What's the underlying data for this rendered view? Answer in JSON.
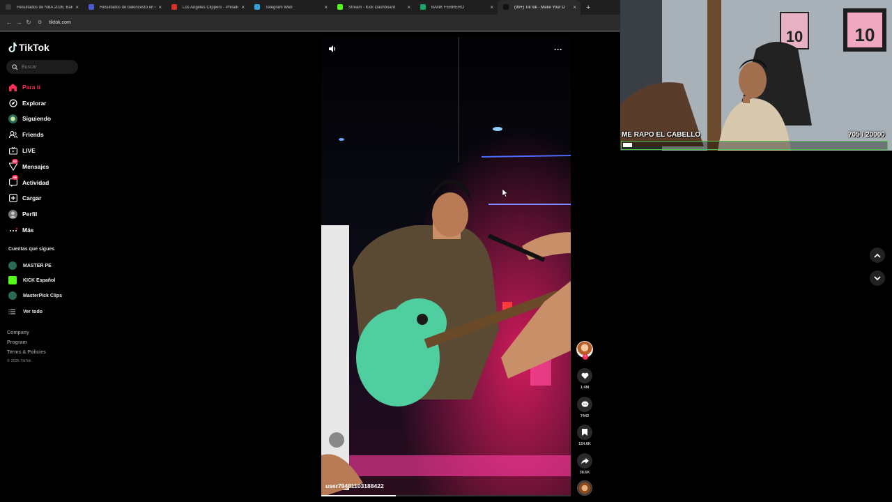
{
  "browser": {
    "tabs": [
      {
        "title": "Resultados de NBA 2026, Balon",
        "color": "#3c3c3c",
        "active": false
      },
      {
        "title": "Resultados de baloncesto en di",
        "color": "#4a5ad6",
        "active": false
      },
      {
        "title": "Los Angeles Clippers - Philadel",
        "color": "#d93025",
        "active": false
      },
      {
        "title": "Telegram Web",
        "color": "#2aa3de",
        "active": false
      },
      {
        "title": "Stream - Kick Dashboard",
        "color": "#53fc18",
        "active": false
      },
      {
        "title": "BANK FEBRERO",
        "color": "#16a765",
        "active": false
      },
      {
        "title": "(99+) TikTok - Make Your D",
        "color": "#111111",
        "active": true
      }
    ],
    "new_tab_label": "+",
    "url": "tiktok.com"
  },
  "sidebar": {
    "logo_text": "TikTok",
    "search_placeholder": "Buscar",
    "nav": [
      {
        "label": "Para ti",
        "icon": "home-icon",
        "active": true
      },
      {
        "label": "Explorar",
        "icon": "compass-icon",
        "active": false
      },
      {
        "label": "Siguiendo",
        "icon": "following-avatar-icon",
        "active": false
      },
      {
        "label": "Friends",
        "icon": "friends-icon",
        "active": false
      },
      {
        "label": "LIVE",
        "icon": "live-tv-icon",
        "active": false
      },
      {
        "label": "Mensajes",
        "icon": "send-icon",
        "active": false,
        "badge": "63"
      },
      {
        "label": "Actividad",
        "icon": "activity-icon",
        "active": false,
        "badge": "99"
      },
      {
        "label": "Cargar",
        "icon": "upload-icon",
        "active": false
      },
      {
        "label": "Perfil",
        "icon": "profile-avatar-icon",
        "active": false
      },
      {
        "label": "Más",
        "icon": "more-dots-icon",
        "active": false
      }
    ],
    "following_title": "Cuentas que sigues",
    "following": [
      {
        "label": "MASTER PE",
        "color": "#2a6a55"
      },
      {
        "label": "KICK Español",
        "color": "#53fc18"
      },
      {
        "label": "MasterPick Clips",
        "color": "#2a6a55"
      },
      {
        "label": "Ver todo",
        "color": ""
      }
    ],
    "footer": [
      "Company",
      "Program",
      "Terms & Policies"
    ],
    "copyright": "© 2026 TikTok"
  },
  "video": {
    "username": "user79481103188422",
    "progress_fraction": 0.3,
    "likes": "1.4M",
    "comments": "7443",
    "saves": "124.6K",
    "shares": "38.6K"
  },
  "overlay": {
    "caption": "ME RAPO EL CABELLO",
    "goal_text": "705  / 20000",
    "goal_current": 705,
    "goal_total": 20000,
    "accent": "#52c34a"
  },
  "colors": {
    "tiktok_red": "#fe2c55"
  }
}
